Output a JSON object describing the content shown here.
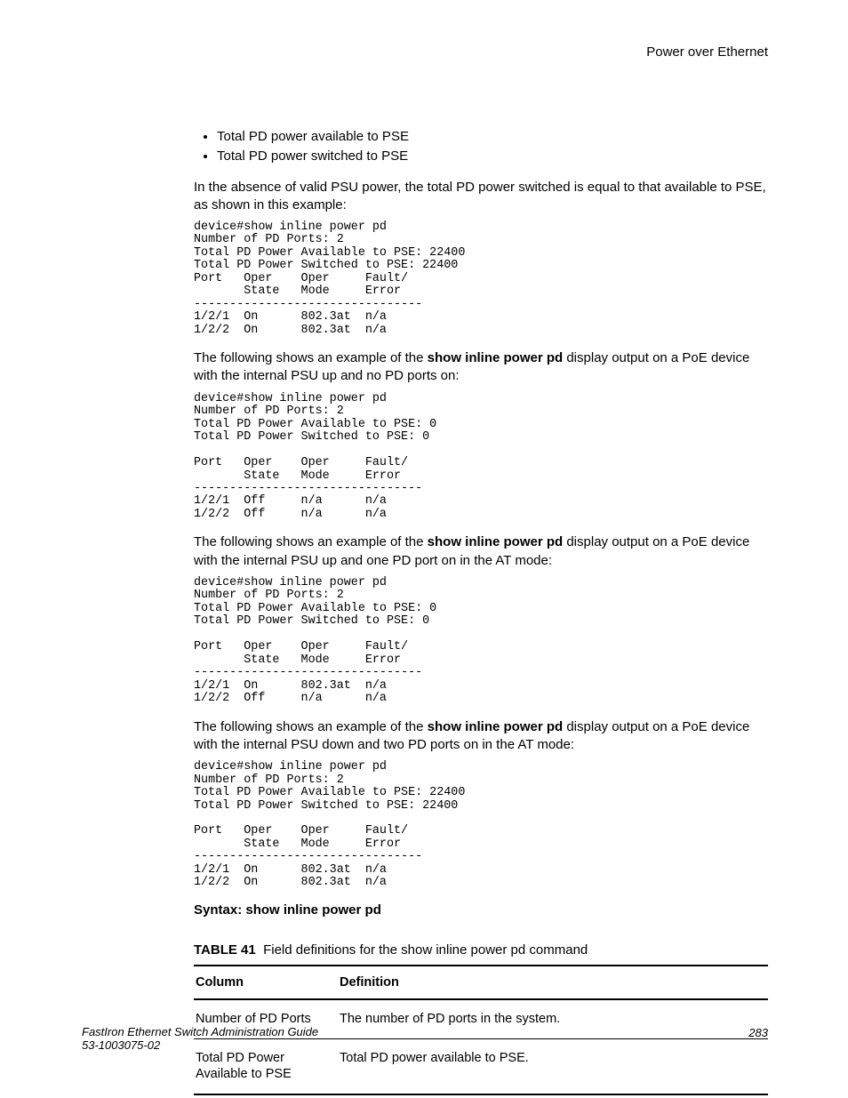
{
  "header": {
    "section": "Power over Ethernet"
  },
  "bullets": [
    "Total PD power available to PSE",
    "Total PD power switched to PSE"
  ],
  "intro": "In the absence of valid PSU power, the total PD power switched is equal to that available to PSE, as shown in this example:",
  "cli1": "device#show inline power pd\nNumber of PD Ports: 2\nTotal PD Power Available to PSE: 22400\nTotal PD Power Switched to PSE: 22400\nPort   Oper    Oper     Fault/\n       State   Mode     Error\n--------------------------------\n1/2/1  On      802.3at  n/a\n1/2/2  On      802.3at  n/a",
  "para2_a": "The following shows an example of the ",
  "para2_cmd": "show inline power pd",
  "para2_b": " display output on a PoE device with the internal PSU up and no PD ports on:",
  "cli2": "device#show inline power pd\nNumber of PD Ports: 2\nTotal PD Power Available to PSE: 0\nTotal PD Power Switched to PSE: 0\n\nPort   Oper    Oper     Fault/\n       State   Mode     Error\n--------------------------------\n1/2/1  Off     n/a      n/a\n1/2/2  Off     n/a      n/a",
  "para3_a": "The following shows an example of the ",
  "para3_cmd": "show inline power pd",
  "para3_b": " display output on a PoE device with the internal PSU up and one PD port on in the AT mode:",
  "cli3": "device#show inline power pd\nNumber of PD Ports: 2\nTotal PD Power Available to PSE: 0\nTotal PD Power Switched to PSE: 0\n\nPort   Oper    Oper     Fault/\n       State   Mode     Error\n--------------------------------\n1/2/1  On      802.3at  n/a\n1/2/2  Off     n/a      n/a",
  "para4_a": "The following shows an example of the ",
  "para4_cmd": "show inline power pd",
  "para4_b": " display output on a PoE device with the internal PSU down and two PD ports on in the AT mode:",
  "cli4": "device#show inline power pd\nNumber of PD Ports: 2\nTotal PD Power Available to PSE: 22400\nTotal PD Power Switched to PSE: 22400\n\nPort   Oper    Oper     Fault/\n       State   Mode     Error\n--------------------------------\n1/2/1  On      802.3at  n/a\n1/2/2  On      802.3at  n/a",
  "syntax": "Syntax: show inline power pd",
  "table": {
    "label": "TABLE 41",
    "title": "Field definitions for the show inline power pd command",
    "head": {
      "c1": "Column",
      "c2": "Definition"
    },
    "rows": [
      {
        "c1": "Number of PD Ports",
        "c2": "The number of PD ports in the system."
      },
      {
        "c1": "Total PD Power Available to PSE",
        "c2": "Total PD power available to PSE."
      }
    ]
  },
  "footer": {
    "line1": "FastIron Ethernet Switch Administration Guide",
    "line2": "53-1003075-02",
    "page": "283"
  }
}
